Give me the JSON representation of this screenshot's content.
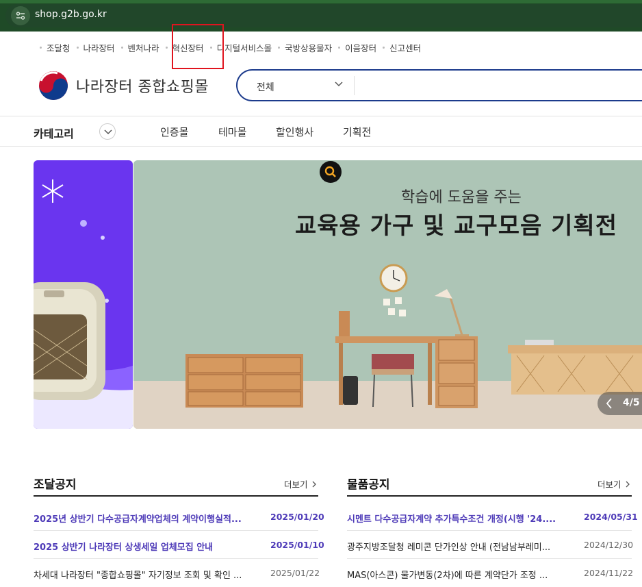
{
  "browser": {
    "url": "shop.g2b.go.kr"
  },
  "top_links": [
    "조달청",
    "나라장터",
    "벤처나라",
    "혁신장터",
    "디지털서비스몰",
    "국방상용물자",
    "이음장터",
    "신고센터"
  ],
  "header": {
    "logo_text": "나라장터 종합쇼핑몰",
    "search_scope": "전체",
    "search_placeholder": ""
  },
  "nav": {
    "category_label": "카테고리",
    "items": [
      "인증몰",
      "테마몰",
      "할인행사",
      "기획전"
    ]
  },
  "banner": {
    "subtitle": "학습에 도움을 주는",
    "headline": "교육용 가구 및 교구모음 기획전",
    "slide_counter": "4/5",
    "colors": {
      "left_bg": "#6a35ef",
      "main_bg": "#adc5b6"
    }
  },
  "notices": {
    "left": {
      "title": "조달공지",
      "more_label": "더보기",
      "rows": [
        {
          "title": "2025년 상반기 다수공급자계약업체의 계약이행실적...",
          "date": "2025/01/20",
          "highlight": true
        },
        {
          "title": "2025 상반기 나라장터 상생세일 업체모집 안내",
          "date": "2025/01/10",
          "highlight": true
        },
        {
          "title": "차세대 나라장터 \"종합쇼핑몰\" 자기정보 조회 및 확인 ...",
          "date": "2025/01/22",
          "highlight": false
        }
      ]
    },
    "right": {
      "title": "물품공지",
      "more_label": "더보기",
      "rows": [
        {
          "title": "시멘트 다수공급자계약 추가특수조건 개정(시행 '24....",
          "date": "2024/05/31",
          "highlight": true
        },
        {
          "title": "광주지방조달청 레미콘 단가인상 안내 (전남남부레미...",
          "date": "2024/12/30",
          "highlight": false
        },
        {
          "title": "MAS(아스콘) 물가변동(2차)에 따른 계약단가 조정 ...",
          "date": "2024/11/22",
          "highlight": false
        }
      ]
    }
  },
  "colors": {
    "accent_purple": "#4e3bb8",
    "search_border": "#1c3b8c",
    "highlight_box": "#e0141e"
  }
}
